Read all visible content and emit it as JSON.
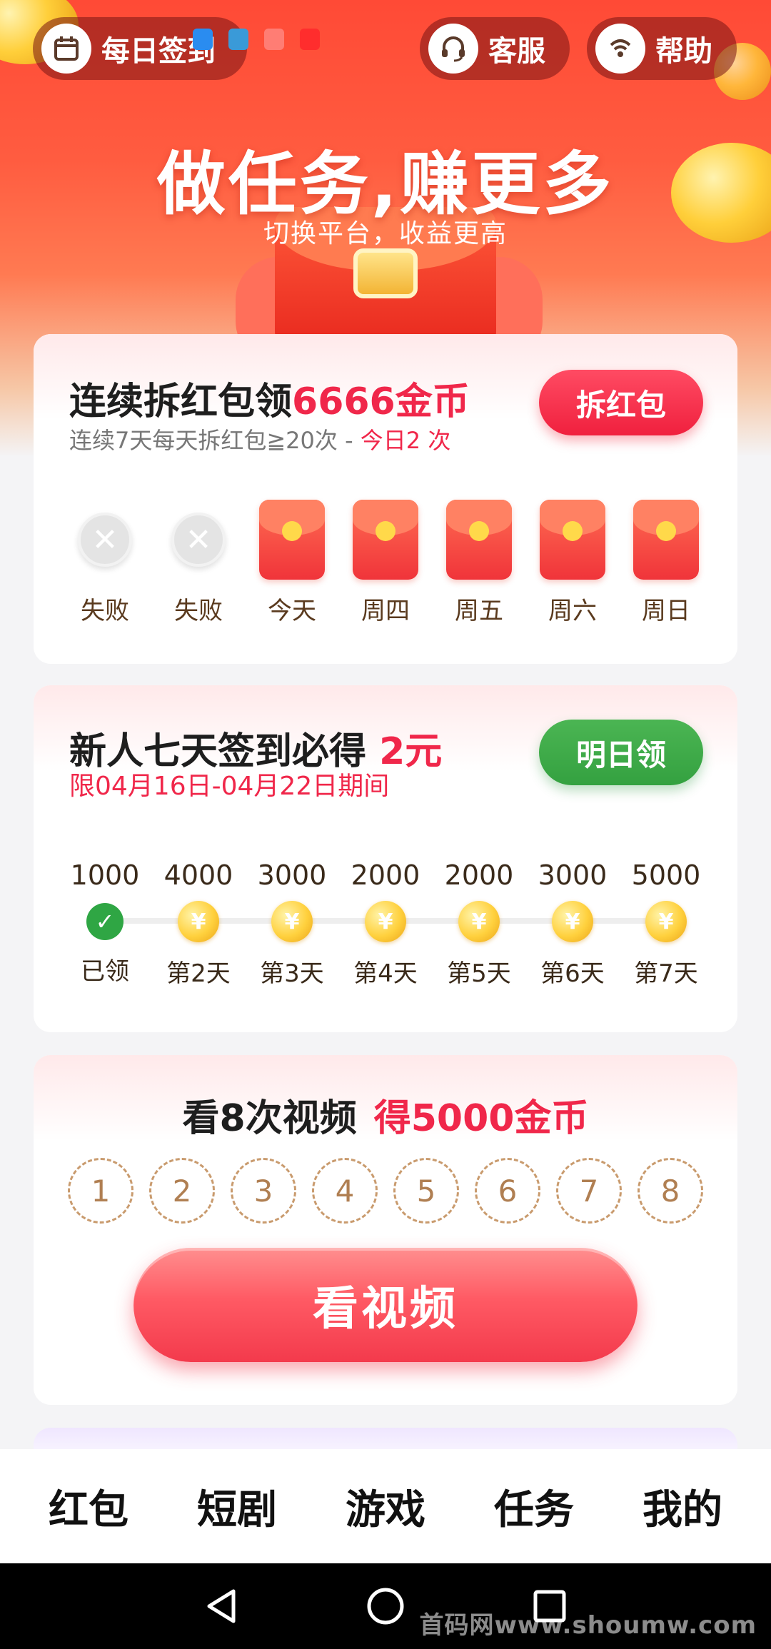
{
  "header": {
    "checkin_label": "每日签到",
    "service_label": "客服",
    "help_label": "帮助",
    "title": "做任务,赚更多",
    "subtitle": "切换平台，收益更高"
  },
  "redpacket_card": {
    "title_prefix": "连续拆红包领",
    "title_highlight": "6666金币",
    "subtitle_prefix": "连续7天每天拆红包≧20次 - ",
    "subtitle_highlight": "今日2 次",
    "button_label": "拆红包",
    "days": [
      {
        "label": "失败",
        "state": "failed"
      },
      {
        "label": "失败",
        "state": "failed"
      },
      {
        "label": "今天",
        "state": "envelope"
      },
      {
        "label": "周四",
        "state": "envelope"
      },
      {
        "label": "周五",
        "state": "envelope"
      },
      {
        "label": "周六",
        "state": "envelope"
      },
      {
        "label": "周日",
        "state": "envelope"
      }
    ]
  },
  "signin_card": {
    "title_prefix": "新人七天签到必得",
    "title_highlight": "2元",
    "subtitle": "限04月16日-04月22日期间",
    "button_label": "明日领",
    "days": [
      {
        "amount": "1000",
        "label": "已领",
        "state": "claimed"
      },
      {
        "amount": "4000",
        "label": "第2天",
        "state": "pending"
      },
      {
        "amount": "3000",
        "label": "第3天",
        "state": "pending"
      },
      {
        "amount": "2000",
        "label": "第4天",
        "state": "pending"
      },
      {
        "amount": "2000",
        "label": "第5天",
        "state": "pending"
      },
      {
        "amount": "3000",
        "label": "第6天",
        "state": "pending"
      },
      {
        "amount": "5000",
        "label": "第7天",
        "state": "pending"
      }
    ]
  },
  "video_card": {
    "title_prefix": "看8次视频",
    "title_highlight": "得5000金币",
    "steps": [
      "1",
      "2",
      "3",
      "4",
      "5",
      "6",
      "7",
      "8"
    ],
    "button_label": "看视频"
  },
  "tabbar": {
    "tabs": [
      {
        "label": "红包",
        "active": false
      },
      {
        "label": "短剧",
        "active": false
      },
      {
        "label": "游戏",
        "active": false
      },
      {
        "label": "任务",
        "active": true
      },
      {
        "label": "我的",
        "active": false
      }
    ]
  },
  "watermark": "首码网www.shoumw.com",
  "colors": {
    "accent_red": "#f0274a",
    "accent_green": "#34a140",
    "hero_red": "#ff4a36"
  },
  "icons": {
    "checkin": "calendar-icon",
    "service": "headset-icon",
    "help": "help-icon",
    "nav_back": "triangle-back-icon",
    "nav_home": "circle-home-icon",
    "nav_recent": "square-recent-icon"
  }
}
